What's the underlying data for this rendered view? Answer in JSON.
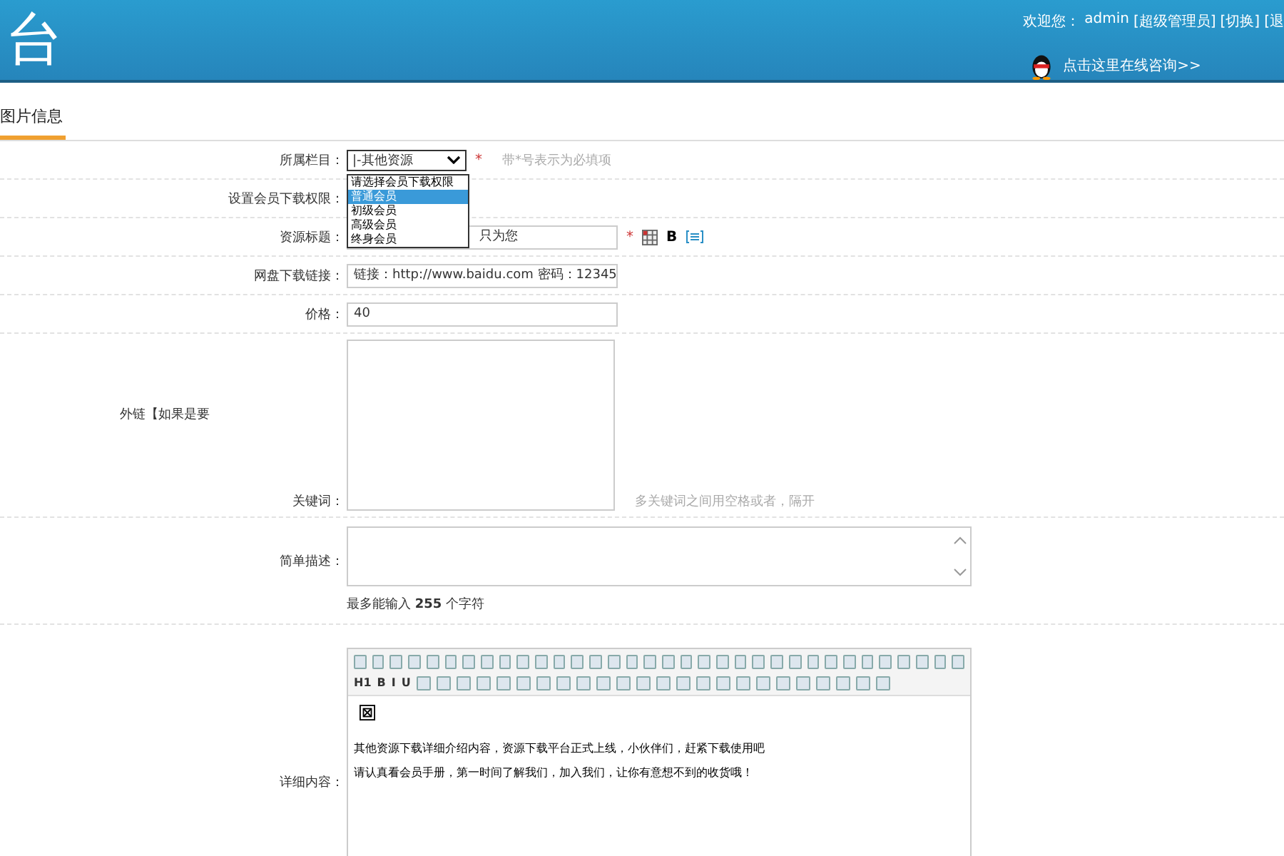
{
  "header": {
    "logo": "台",
    "welcome": "欢迎您：",
    "user": "admin",
    "links": [
      "[超级管理员]",
      "[切换]",
      "[退"
    ],
    "consult": "点击这里在线咨询>>"
  },
  "tabs": [
    {
      "label": "图片信息",
      "selected": true
    }
  ],
  "form": [
    {
      "kind": "select",
      "label": "所属栏目：",
      "value": "|-其他资源",
      "required": "*",
      "hint": "带*号表示为必填项"
    },
    {
      "kind": "dropdown",
      "label": "设置会员下载权限：",
      "options": [
        {
          "label": "请选择会员下载权限",
          "selected": false
        },
        {
          "label": "普通会员",
          "selected": true
        },
        {
          "label": "初级会员",
          "selected": false
        },
        {
          "label": "高级会员",
          "selected": false
        },
        {
          "label": "终身会员",
          "selected": false
        }
      ]
    },
    {
      "kind": "title",
      "label": "资源标题：",
      "value": "只为您",
      "required": "*",
      "bold": "B"
    },
    {
      "kind": "text",
      "label": "网盘下载链接：",
      "value": "链接：http://www.baidu.com 密码：12345"
    },
    {
      "kind": "text",
      "label": "价格：",
      "value": "40"
    },
    {
      "kind": "keywords",
      "note": "外链【如果是要",
      "label": "关键词：",
      "hint": "多关键词之间用空格或者，隔开"
    },
    {
      "kind": "description",
      "label": "简单描述：",
      "note": "最多能输入 **255** 个字符"
    },
    {
      "kind": "editor",
      "label": "详细内容：",
      "toolbar": [
        "H1",
        "B",
        "I",
        "U"
      ],
      "lines": [
        "其他资源下载详细介绍内容，资源下载平台正式上线，小伙伴们，赶紧下载使用吧",
        "请认真看会员手册，第一时间了解我们，加入我们，让你有意想不到的收货哦！"
      ]
    }
  ]
}
